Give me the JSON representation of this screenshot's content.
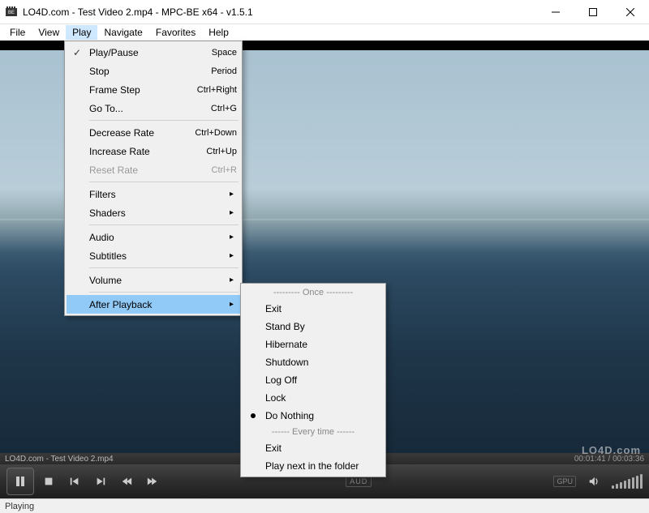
{
  "window": {
    "title": "LO4D.com - Test Video 2.mp4 - MPC-BE x64 - v1.5.1"
  },
  "menubar": {
    "items": [
      "File",
      "View",
      "Play",
      "Navigate",
      "Favorites",
      "Help"
    ],
    "active_index": 2
  },
  "play_menu": {
    "groups": [
      [
        {
          "label": "Play/Pause",
          "shortcut": "Space",
          "checked": true
        },
        {
          "label": "Stop",
          "shortcut": "Period"
        },
        {
          "label": "Frame Step",
          "shortcut": "Ctrl+Right"
        },
        {
          "label": "Go To...",
          "shortcut": "Ctrl+G"
        }
      ],
      [
        {
          "label": "Decrease Rate",
          "shortcut": "Ctrl+Down"
        },
        {
          "label": "Increase Rate",
          "shortcut": "Ctrl+Up"
        },
        {
          "label": "Reset Rate",
          "shortcut": "Ctrl+R",
          "disabled": true
        }
      ],
      [
        {
          "label": "Filters",
          "submenu": true
        },
        {
          "label": "Shaders",
          "submenu": true
        }
      ],
      [
        {
          "label": "Audio",
          "submenu": true
        },
        {
          "label": "Subtitles",
          "submenu": true
        }
      ],
      [
        {
          "label": "Volume",
          "submenu": true
        }
      ],
      [
        {
          "label": "After Playback",
          "submenu": true,
          "highlighted": true
        }
      ]
    ]
  },
  "after_playback_submenu": {
    "header_once": "--------- Once ---------",
    "once_items": [
      "Exit",
      "Stand By",
      "Hibernate",
      "Shutdown",
      "Log Off",
      "Lock",
      "Do Nothing"
    ],
    "selected_once": "Do Nothing",
    "header_every": "------ Every time ------",
    "every_items": [
      "Exit",
      "Play next in the folder"
    ]
  },
  "seekbar": {
    "file_label": "LO4D.com - Test Video 2.mp4",
    "time": "00:01:41 / 00:03:36"
  },
  "controls": {
    "aud_label": "AUD",
    "gpu_label": "GPU"
  },
  "status": {
    "text": "Playing"
  },
  "watermark": "LO4D.com"
}
